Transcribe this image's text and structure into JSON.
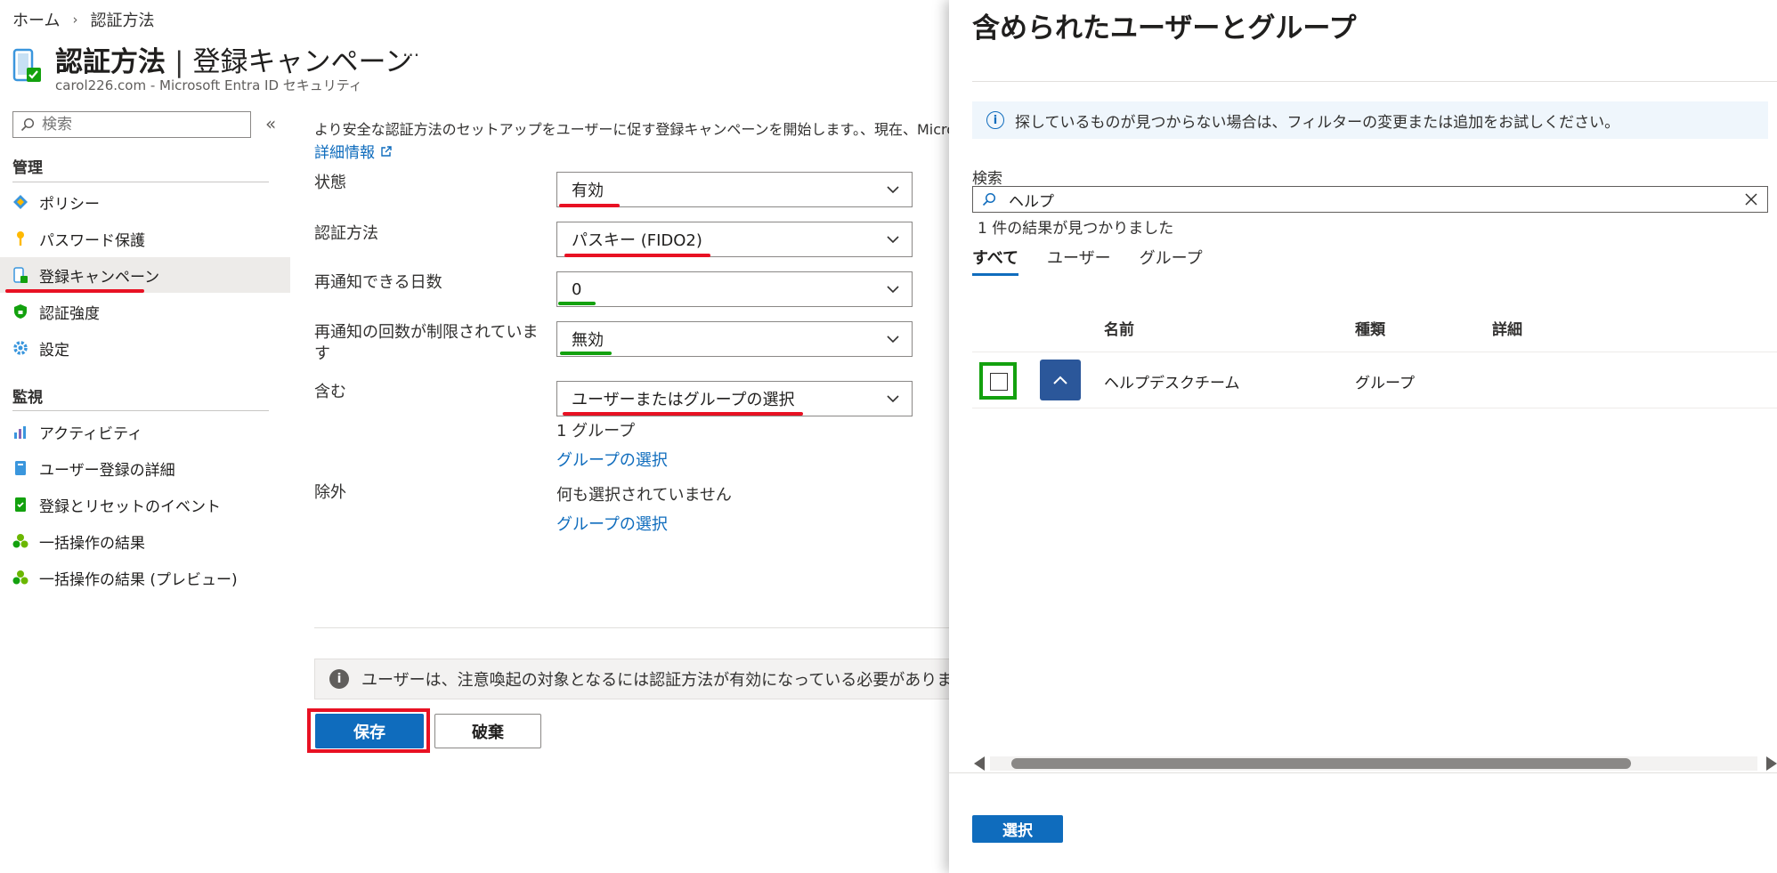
{
  "breadcrumb": {
    "home": "ホーム",
    "current": "認証方法"
  },
  "header": {
    "title_main": "認証方法",
    "title_sep": "|",
    "title_sub": "登録キャンペーン",
    "more": "···",
    "subtitle": "carol226.com - Microsoft Entra ID セキュリティ"
  },
  "sidebar": {
    "search_placeholder": "検索",
    "collapse": "«",
    "section_manage": "管理",
    "manage_items": [
      {
        "label": "ポリシー",
        "icon": "policy-icon"
      },
      {
        "label": "パスワード保護",
        "icon": "key-icon"
      },
      {
        "label": "登録キャンペーン",
        "icon": "registration-campaign-icon"
      },
      {
        "label": "認証強度",
        "icon": "shield-icon"
      },
      {
        "label": "設定",
        "icon": "gear-icon"
      }
    ],
    "section_monitor": "監視",
    "monitor_items": [
      {
        "label": "アクティビティ",
        "icon": "activity-chart-icon"
      },
      {
        "label": "ユーザー登録の詳細",
        "icon": "user-details-icon"
      },
      {
        "label": "登録とリセットのイベント",
        "icon": "events-icon"
      },
      {
        "label": "一括操作の結果",
        "icon": "bulk-results-icon"
      },
      {
        "label": "一括操作の結果 (プレビュー)",
        "icon": "bulk-results-preview-icon"
      }
    ]
  },
  "main": {
    "intro": "より安全な認証方法のセットアップをユーザーに促す登録キャンペーンを開始します。、現在、Microsoft",
    "learn_more": "詳細情報",
    "fields": {
      "state": {
        "label": "状態",
        "value": "有効"
      },
      "method": {
        "label": "認証方法",
        "value": "パスキー (FIDO2)"
      },
      "snooze_days": {
        "label": "再通知できる日数",
        "value": "0"
      },
      "limited": {
        "label": "再通知の回数が制限されています",
        "value": "無効"
      },
      "include": {
        "label": "含む",
        "value": "ユーザーまたはグループの選択",
        "count": "1 グループ",
        "link": "グループの選択"
      },
      "exclude": {
        "label": "除外",
        "value": "何も選択されていません",
        "link": "グループの選択"
      }
    },
    "info_bar": "ユーザーは、注意喚起の対象となるには認証方法が有効になっている必要がありま",
    "save": "保存",
    "discard": "破棄"
  },
  "panel": {
    "title": "含められたユーザーとグループ",
    "info": "探しているものが見つからない場合は、フィルターの変更または追加をお試しください。",
    "search_label": "検索",
    "search_value": "ヘルプ",
    "result_count": "1 件の結果が見つかりました",
    "tabs": [
      "すべて",
      "ユーザー",
      "グループ"
    ],
    "columns": {
      "name": "名前",
      "type": "種類",
      "details": "詳細"
    },
    "rows": [
      {
        "name": "ヘルプデスクチーム",
        "type": "グループ",
        "details": ""
      }
    ],
    "select_button": "選択"
  },
  "colors": {
    "accent": "#0f6cbd",
    "highlight_red": "#e81123",
    "highlight_green": "#13a10e"
  }
}
